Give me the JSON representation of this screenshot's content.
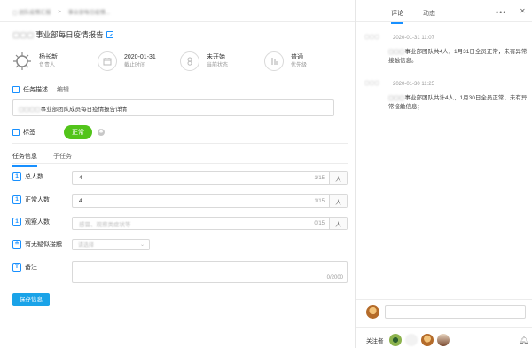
{
  "breadcrumb": {
    "level1": "团队疫情汇报",
    "separator": ">",
    "level2": "事业部每日疫情..."
  },
  "task": {
    "title": "事业部每日疫情报告",
    "owner_name": "杨长新",
    "owner_label": "负责人",
    "deadline_value": "2020-01-31",
    "deadline_label": "截止时间",
    "status_value": "未开始",
    "status_label": "当前状态",
    "priority_value": "普通",
    "priority_label": "优先级"
  },
  "description": {
    "tab_label": "任务描述",
    "edit_label": "编辑",
    "content": "事业部团队成员每日疫情报告详情"
  },
  "tag": {
    "label": "标签",
    "value": "正常",
    "color": "#52c41a"
  },
  "sub_tabs": {
    "info": "任务信息",
    "subtask": "子任务"
  },
  "form": {
    "total": {
      "label": "总人数",
      "value": "4",
      "count": "1/15",
      "unit": "人"
    },
    "normal": {
      "label": "正常人数",
      "value": "4",
      "count": "1/15",
      "unit": "人"
    },
    "observe": {
      "label": "观察人数",
      "placeholder": "感冒、观察类症状等",
      "count": "0/15",
      "unit": "人"
    },
    "contact": {
      "label": "有无疑似接触",
      "placeholder": "请选择"
    },
    "remark": {
      "label": "备注",
      "count": "0/2000"
    },
    "save_label": "保存信息"
  },
  "right_panel": {
    "tab_comment": "评论",
    "tab_activity": "动态",
    "more": "•••",
    "close": "✕",
    "comments": [
      {
        "time": "2020-01-31 11:07",
        "text": "事业部团队共4人，1月31日全员正常，未有异常接触信息。"
      },
      {
        "time": "2020-01-30 11:25",
        "text": "事业部团队共计4人，1月30日全员正常，未有异常接触信息；"
      }
    ],
    "followers_label": "关注者",
    "add_follower": "+"
  },
  "colors": {
    "accent": "#1890ff",
    "save_button": "#1aa3e8",
    "tag_green": "#52c41a"
  }
}
